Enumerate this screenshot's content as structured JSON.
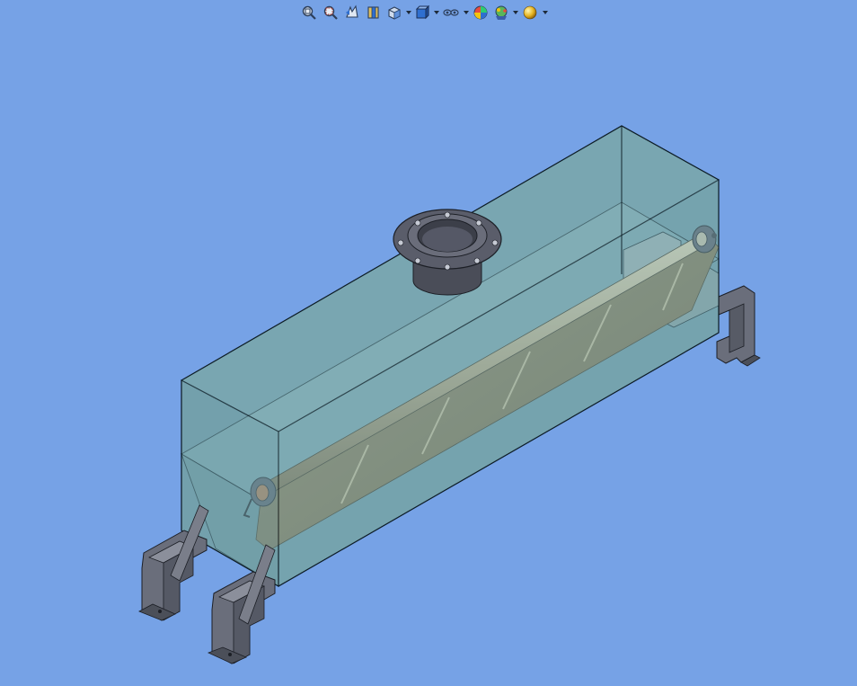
{
  "viewport": {
    "background_color": "#76a2e6"
  },
  "heads_up_toolbar": {
    "tools": [
      {
        "icon": "zoom-to-fit-icon",
        "has_dropdown": false
      },
      {
        "icon": "zoom-to-area-icon",
        "has_dropdown": false
      },
      {
        "icon": "previous-view-icon",
        "has_dropdown": false
      },
      {
        "icon": "section-view-icon",
        "has_dropdown": false
      },
      {
        "icon": "view-orientation-icon",
        "has_dropdown": true
      },
      {
        "icon": "display-style-icon",
        "has_dropdown": true
      },
      {
        "icon": "hide-show-items-icon",
        "has_dropdown": true
      },
      {
        "icon": "edit-appearance-icon",
        "has_dropdown": false
      },
      {
        "icon": "apply-scene-icon",
        "has_dropdown": true
      },
      {
        "icon": "view-settings-icon",
        "has_dropdown": true
      }
    ]
  },
  "model": {
    "tank_glass_color": "#7fb0b8",
    "tank_edge_color": "#0b1a22",
    "shaft_color": "#b6a784",
    "screw_blade_color": "#8c7f5c",
    "flange_color": "#5a5d6a",
    "support_color": "#6a6e7b"
  }
}
